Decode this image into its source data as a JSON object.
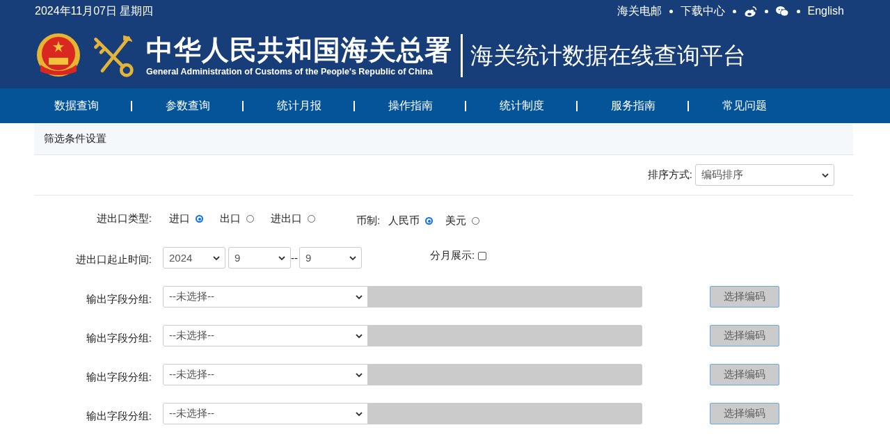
{
  "header": {
    "date": "2024年11月07日 星期四",
    "top_links": [
      {
        "kind": "text",
        "label": "海关电邮"
      },
      {
        "kind": "text",
        "label": "下载中心"
      },
      {
        "kind": "weibo"
      },
      {
        "kind": "wechat"
      },
      {
        "kind": "text",
        "label": "English"
      }
    ],
    "org_name_cn": "中华人民共和国海关总署",
    "org_name_en": "General Administration of Customs of the People's Republic of China",
    "platform_title": "海关统计数据在线查询平台"
  },
  "nav": [
    {
      "label": "数据查询"
    },
    {
      "label": "参数查询"
    },
    {
      "label": "统计月报"
    },
    {
      "label": "操作指南"
    },
    {
      "label": "统计制度"
    },
    {
      "label": "服务指南"
    },
    {
      "label": "常见问题"
    }
  ],
  "panel": {
    "title": "筛选条件设置",
    "sort": {
      "label": "排序方式:",
      "value": "编码排序"
    },
    "trade_type": {
      "label": "进出口类型:",
      "options": [
        {
          "label": "进口",
          "selected": true
        },
        {
          "label": "出口",
          "selected": false
        },
        {
          "label": "进出口",
          "selected": false
        }
      ]
    },
    "currency": {
      "label": "币制:",
      "options": [
        {
          "label": "人民币",
          "selected": true
        },
        {
          "label": "美元",
          "selected": false
        }
      ]
    },
    "period": {
      "label": "进出口起止时间:",
      "year": "2024",
      "start_month": "9",
      "separator": "--",
      "end_month": "9"
    },
    "monthly": {
      "label": "分月展示:",
      "checked": false
    },
    "field_groups": [
      {
        "label": "输出字段分组:",
        "value": "--未选择--",
        "button": "选择编码",
        "disabled": true
      },
      {
        "label": "输出字段分组:",
        "value": "--未选择--",
        "button": "选择编码",
        "disabled": true
      },
      {
        "label": "输出字段分组:",
        "value": "--未选择--",
        "button": "选择编码",
        "disabled": true
      },
      {
        "label": "输出字段分组:",
        "value": "--未选择--",
        "button": "选择编码",
        "disabled": true
      }
    ]
  }
}
